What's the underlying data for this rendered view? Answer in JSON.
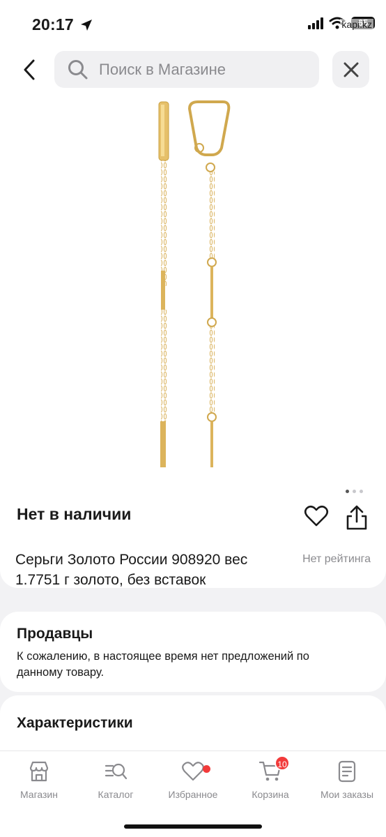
{
  "status_bar": {
    "time": "20:17",
    "battery": "65",
    "watermark": "kapi.kz"
  },
  "search": {
    "placeholder": "Поиск в Магазине"
  },
  "product": {
    "availability": "Нет в наличии",
    "title": "Серьги Золото России 908920 вес 1.7751 г золото, без вставок",
    "rating": "Нет рейтинга",
    "image_count": 3,
    "active_image": 1
  },
  "sellers": {
    "title": "Продавцы",
    "text": "К сожалению, в настоящее время нет предложений по данному товару."
  },
  "characteristics": {
    "title": "Характеристики"
  },
  "tabbar": {
    "tabs": [
      {
        "label": "Магазин",
        "icon": "store-icon"
      },
      {
        "label": "Каталог",
        "icon": "catalog-search-icon"
      },
      {
        "label": "Избранное",
        "icon": "heart-icon"
      },
      {
        "label": "Корзина",
        "icon": "cart-icon",
        "badge": "10"
      },
      {
        "label": "Мои заказы",
        "icon": "orders-icon"
      }
    ]
  },
  "colors": {
    "accent_red": "#f23a3a",
    "gold": "#d9b15a",
    "muted_text": "#8a8a8e"
  }
}
